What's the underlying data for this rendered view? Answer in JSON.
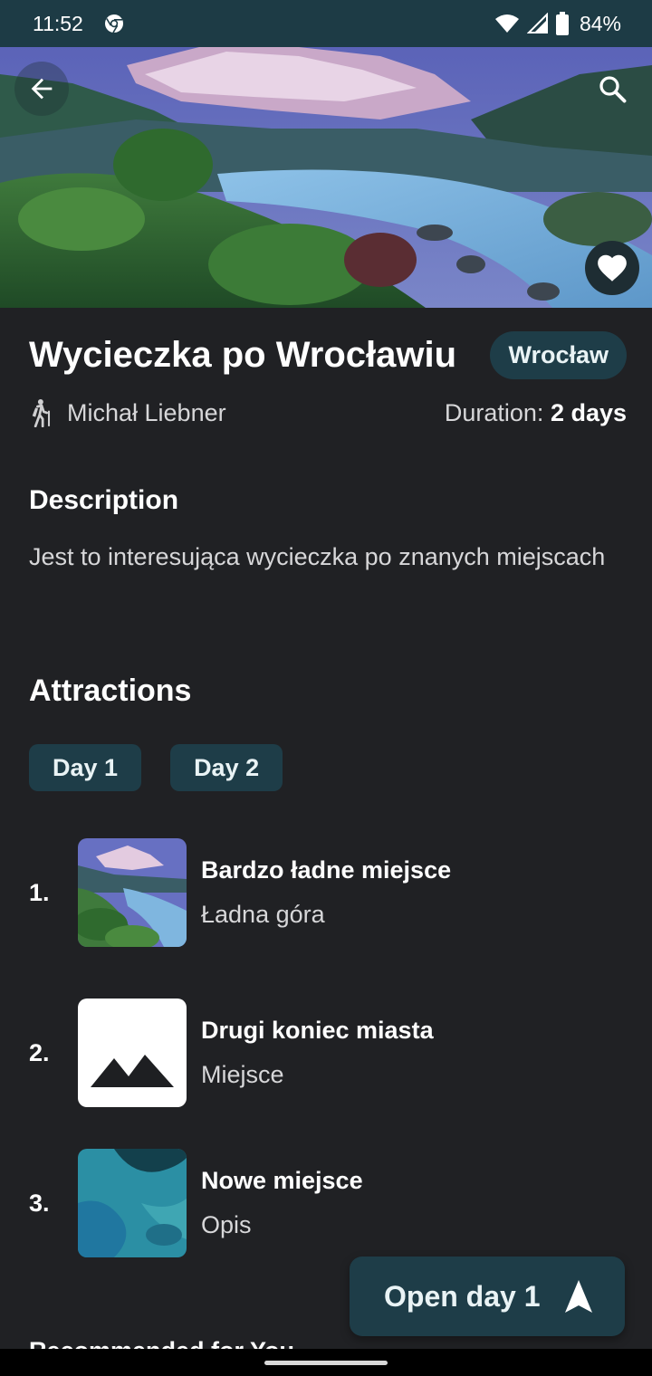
{
  "status_bar": {
    "time": "11:52",
    "battery": "84%",
    "icons": [
      "chrome-icon",
      "wifi-icon",
      "signal-icon",
      "battery-icon"
    ]
  },
  "hero": {
    "image": "mountain-valley-river-photo",
    "back_icon": "arrow-back-icon",
    "search_icon": "search-icon",
    "favorite_icon": "heart-icon"
  },
  "tour": {
    "title": "Wycieczka po Wrocławiu",
    "city": "Wrocław",
    "author": "Michał Liebner",
    "author_icon": "hiking-icon",
    "duration_label": "Duration: ",
    "duration_value": "2 days"
  },
  "description": {
    "heading": "Description",
    "text": "Jest to interesująca wycieczka po znanych miejscach"
  },
  "attractions": {
    "heading": "Attractions",
    "day_tabs": [
      "Day 1",
      "Day 2"
    ],
    "items": [
      {
        "number": "1.",
        "title": "Bardzo ładne miejsce",
        "subtitle": "Ładna góra",
        "thumb": "mountain-photo"
      },
      {
        "number": "2.",
        "title": "Drugi koniec miasta",
        "subtitle": "Miejsce",
        "thumb": "image-placeholder-icon"
      },
      {
        "number": "3.",
        "title": "Nowe miejsce",
        "subtitle": "Opis",
        "thumb": "water-photo"
      }
    ]
  },
  "open_day_button": {
    "label": "Open day 1",
    "icon": "navigation-arrow-icon"
  },
  "recommended": {
    "heading": "Recommended for You"
  },
  "colors": {
    "background": "#202124",
    "accent": "#1e3d48",
    "status_bar": "#1d3b45"
  }
}
